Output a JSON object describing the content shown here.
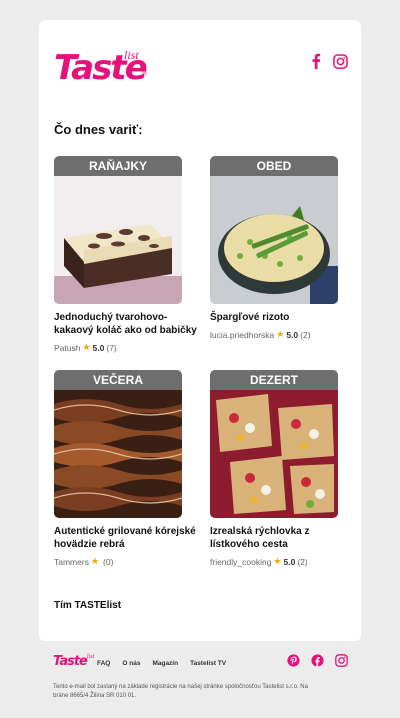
{
  "brand": {
    "name": "Taste",
    "sub": "list",
    "reg": "®",
    "accent": "#e6117a"
  },
  "header": {
    "social": [
      "facebook-icon",
      "instagram-icon"
    ]
  },
  "heading": "Čo dnes variť:",
  "recipes": [
    {
      "category": "RAŇAJKY",
      "title": "Jednoduchý tvarohovo-kakaový koláč ako od babičky",
      "author": "Patush",
      "rating": "5.0",
      "reviews": "(7)"
    },
    {
      "category": "OBED",
      "title": "Špargľové rizoto",
      "author": "lucia.priedhorska",
      "rating": "5.0",
      "reviews": "(2)"
    },
    {
      "category": "VEČERA",
      "title": "Autentické grilované kórejské hovädzie rebrá",
      "author": "Tammers",
      "rating": "",
      "reviews": "(0)"
    },
    {
      "category": "DEZERT",
      "title": "Izrealská rýchlovka z lístkového cesta",
      "author": "friendly_cooking",
      "rating": "5.0",
      "reviews": "(2)"
    }
  ],
  "signoff": "Tím TASTElist",
  "footer": {
    "links": [
      "FAQ",
      "O nás",
      "Magazín",
      "Tastelist TV"
    ],
    "social": [
      "pinterest-icon",
      "facebook-icon",
      "instagram-icon"
    ],
    "disclaimer": "Tento e-mail bol zaslaný na základe registrácie na našej stránke spoločnosťou Tastelist s.r.o. Na bráne 8665/4 Žilina SR 010 01."
  }
}
